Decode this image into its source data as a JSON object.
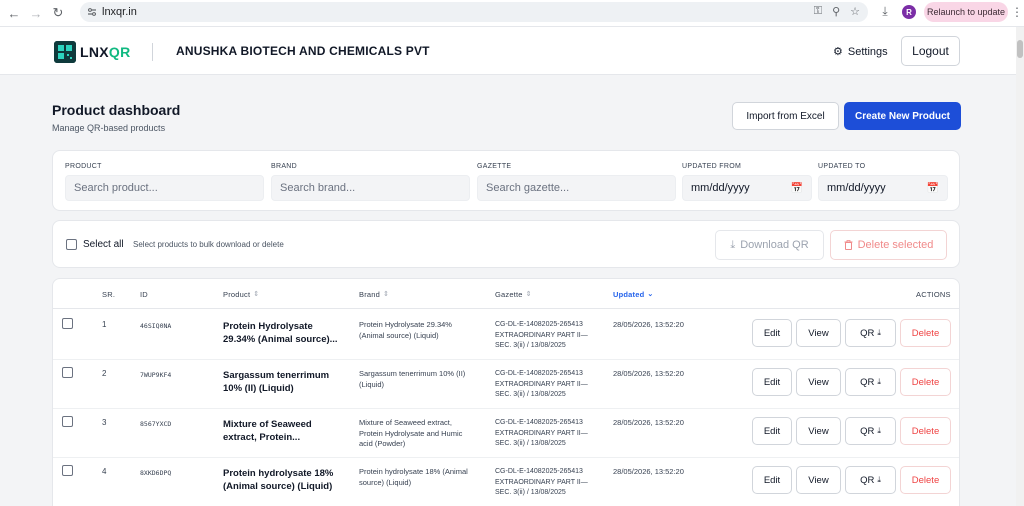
{
  "browser": {
    "url": "lnxqr.in",
    "profile_initial": "R",
    "relaunch_label": "Relaunch to update"
  },
  "header": {
    "logo_text_1": "LNX",
    "logo_text_2": "QR",
    "company_name": "ANUSHKA BIOTECH AND CHEMICALS PVT",
    "settings_label": "Settings",
    "logout_label": "Logout"
  },
  "page": {
    "title": "Product dashboard",
    "subtitle": "Manage QR-based products",
    "import_label": "Import from Excel",
    "create_label": "Create New Product"
  },
  "filters": {
    "product_label": "PRODUCT",
    "product_placeholder": "Search product...",
    "brand_label": "BRAND",
    "brand_placeholder": "Search brand...",
    "gazette_label": "GAZETTE",
    "gazette_placeholder": "Search gazette...",
    "updated_from_label": "UPDATED FROM",
    "updated_from_value": "mm/dd/yyyy",
    "updated_to_label": "UPDATED TO",
    "updated_to_value": "mm/dd/yyyy"
  },
  "bulk": {
    "select_all_label": "Select all",
    "hint": "Select products to bulk download or delete",
    "download_label": "Download QR",
    "delete_label": "Delete selected"
  },
  "table": {
    "columns": {
      "sr": "SR.",
      "id": "ID",
      "product": "Product",
      "brand": "Brand",
      "gazette": "Gazette",
      "updated": "Updated",
      "actions": "ACTIONS"
    },
    "action_labels": {
      "edit": "Edit",
      "view": "View",
      "qr": "QR",
      "delete": "Delete"
    },
    "rows": [
      {
        "sr": "1",
        "id": "46SIQ0NA",
        "product": "Protein Hydrolysate 29.34% (Animal source)...",
        "brand": "Protein Hydrolysate 29.34% (Animal source) (Liquid)",
        "gazette": "CG-DL-E-14082025-265413 EXTRAORDINARY PART II— SEC. 3(ii) / 13/08/2025",
        "updated": "28/05/2026, 13:52:20"
      },
      {
        "sr": "2",
        "id": "7WUP9KF4",
        "product": "Sargassum tenerrimum 10% (II) (Liquid)",
        "brand": "Sargassum tenerrimum 10% (II) (Liquid)",
        "gazette": "CG-DL-E-14082025-265413 EXTRAORDINARY PART II— SEC. 3(ii) / 13/08/2025",
        "updated": "28/05/2026, 13:52:20"
      },
      {
        "sr": "3",
        "id": "8567YXCD",
        "product": "Mixture of Seaweed extract, Protein...",
        "brand": "Mixture of Seaweed extract, Protein Hydrolysate and Humic acid (Powder)",
        "gazette": "CG-DL-E-14082025-265413 EXTRAORDINARY PART II— SEC. 3(ii) / 13/08/2025",
        "updated": "28/05/2026, 13:52:20"
      },
      {
        "sr": "4",
        "id": "8XKD6DPQ",
        "product": "Protein hydrolysate 18% (Animal source) (Liquid)",
        "brand": "Protein hydrolysate 18% (Animal source) (Liquid)",
        "gazette": "CG-DL-E-14082025-265413 EXTRAORDINARY PART II— SEC. 3(ii) / 13/08/2025",
        "updated": "28/05/2026, 13:52:20"
      }
    ]
  }
}
